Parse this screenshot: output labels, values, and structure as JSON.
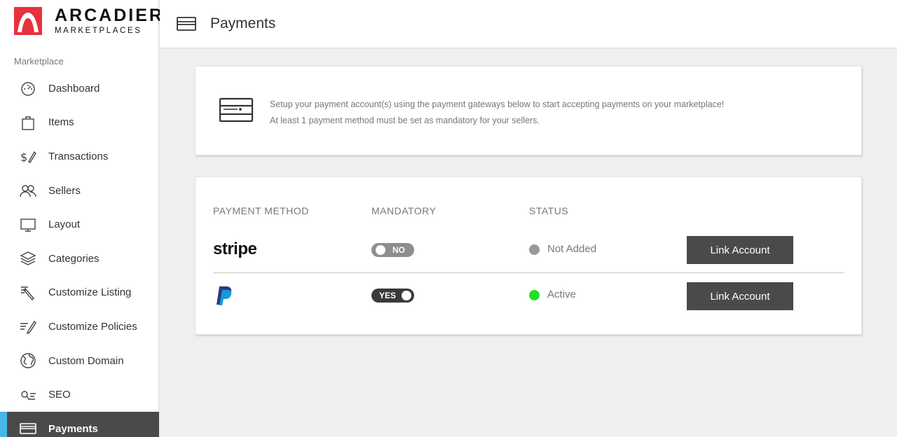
{
  "brand": {
    "line1": "ARCADIER",
    "line2": "MARKETPLACES",
    "accent": "#e8313f"
  },
  "sidebar": {
    "section_label": "Marketplace",
    "items": [
      {
        "label": "Dashboard",
        "icon": "dashboard-icon"
      },
      {
        "label": "Items",
        "icon": "items-icon"
      },
      {
        "label": "Transactions",
        "icon": "transactions-icon"
      },
      {
        "label": "Sellers",
        "icon": "sellers-icon"
      },
      {
        "label": "Layout",
        "icon": "layout-icon"
      },
      {
        "label": "Categories",
        "icon": "categories-icon"
      },
      {
        "label": "Customize Listing",
        "icon": "customize-listing-icon"
      },
      {
        "label": "Customize Policies",
        "icon": "customize-policies-icon"
      },
      {
        "label": "Custom Domain",
        "icon": "globe-icon"
      },
      {
        "label": "SEO",
        "icon": "seo-icon"
      },
      {
        "label": "Payments",
        "icon": "payment-card-icon",
        "active": true
      }
    ],
    "active_color": "#4a4a4a",
    "active_indicator_color": "#45b7e9"
  },
  "header": {
    "title": "Payments",
    "icon": "payment-card-icon"
  },
  "info": {
    "line1": "Setup your payment account(s) using the payment gateways below to start accepting payments on your marketplace!",
    "line2": "At least 1 payment method must be set as mandatory for your sellers."
  },
  "table": {
    "columns": {
      "method": "PAYMENT METHOD",
      "mandatory": "MANDATORY",
      "status": "STATUS"
    },
    "rows": [
      {
        "method": "stripe",
        "method_logo": "stripe-logo",
        "mandatory_label": "NO",
        "mandatory": false,
        "status": "Not Added",
        "status_color": "#999999",
        "action": "Link Account"
      },
      {
        "method": "PayPal",
        "method_logo": "paypal-logo",
        "mandatory_label": "YES",
        "mandatory": true,
        "status": "Active",
        "status_color": "#22e022",
        "action": "Link Account"
      }
    ]
  }
}
